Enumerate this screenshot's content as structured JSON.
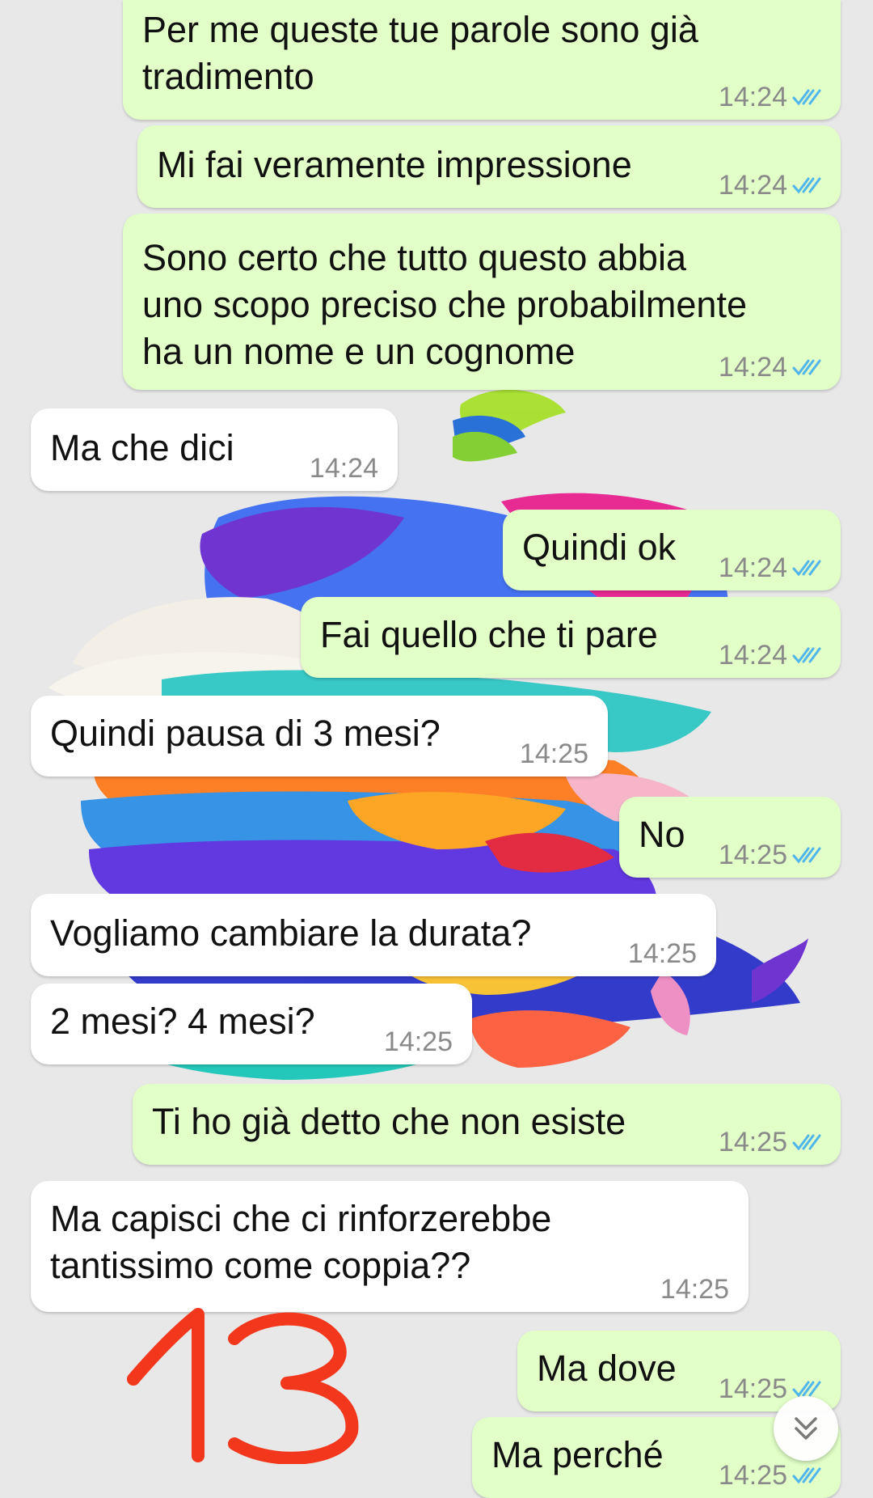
{
  "messages": [
    {
      "dir": "out",
      "text": "Per me queste tue parole sono già\ntradimento",
      "time": "14:24",
      "status": "read"
    },
    {
      "dir": "out",
      "text": "Mi fai veramente impressione",
      "time": "14:24",
      "status": "read"
    },
    {
      "dir": "out",
      "text": "Sono certo che tutto questo abbia\nuno scopo preciso che probabilmente\nha un nome e un cognome",
      "time": "14:24",
      "status": "read"
    },
    {
      "dir": "in",
      "text": "Ma che dici",
      "time": "14:24"
    },
    {
      "dir": "out",
      "text": "Quindi ok",
      "time": "14:24",
      "status": "read"
    },
    {
      "dir": "out",
      "text": "Fai quello che ti pare",
      "time": "14:24",
      "status": "read"
    },
    {
      "dir": "in",
      "text": "Quindi pausa di 3 mesi?",
      "time": "14:25"
    },
    {
      "dir": "out",
      "text": "No",
      "time": "14:25",
      "status": "read"
    },
    {
      "dir": "in",
      "text": "Vogliamo cambiare la durata?",
      "time": "14:25"
    },
    {
      "dir": "in",
      "text": "2 mesi? 4 mesi?",
      "time": "14:25"
    },
    {
      "dir": "out",
      "text": "Ti ho già detto che non esiste",
      "time": "14:25",
      "status": "read"
    },
    {
      "dir": "in",
      "text": "Ma capisci che ci rinforzerebbe\ntantissimo come coppia??",
      "time": "14:25"
    },
    {
      "dir": "out",
      "text": "Ma dove",
      "time": "14:25",
      "status": "read"
    },
    {
      "dir": "out",
      "text": "Ma perché",
      "time": "14:25",
      "status": "read"
    }
  ],
  "annotation": {
    "text": "13",
    "color": "#f2371c"
  },
  "colors": {
    "outgoing_bubble": "#e1ffc7",
    "incoming_bubble": "#ffffff",
    "read_ticks": "#4fb6ec",
    "timestamp": "#8a8a8a",
    "background": "#e8e8e8"
  },
  "scroll_button": {
    "icon": "double-chevron-down-icon"
  }
}
